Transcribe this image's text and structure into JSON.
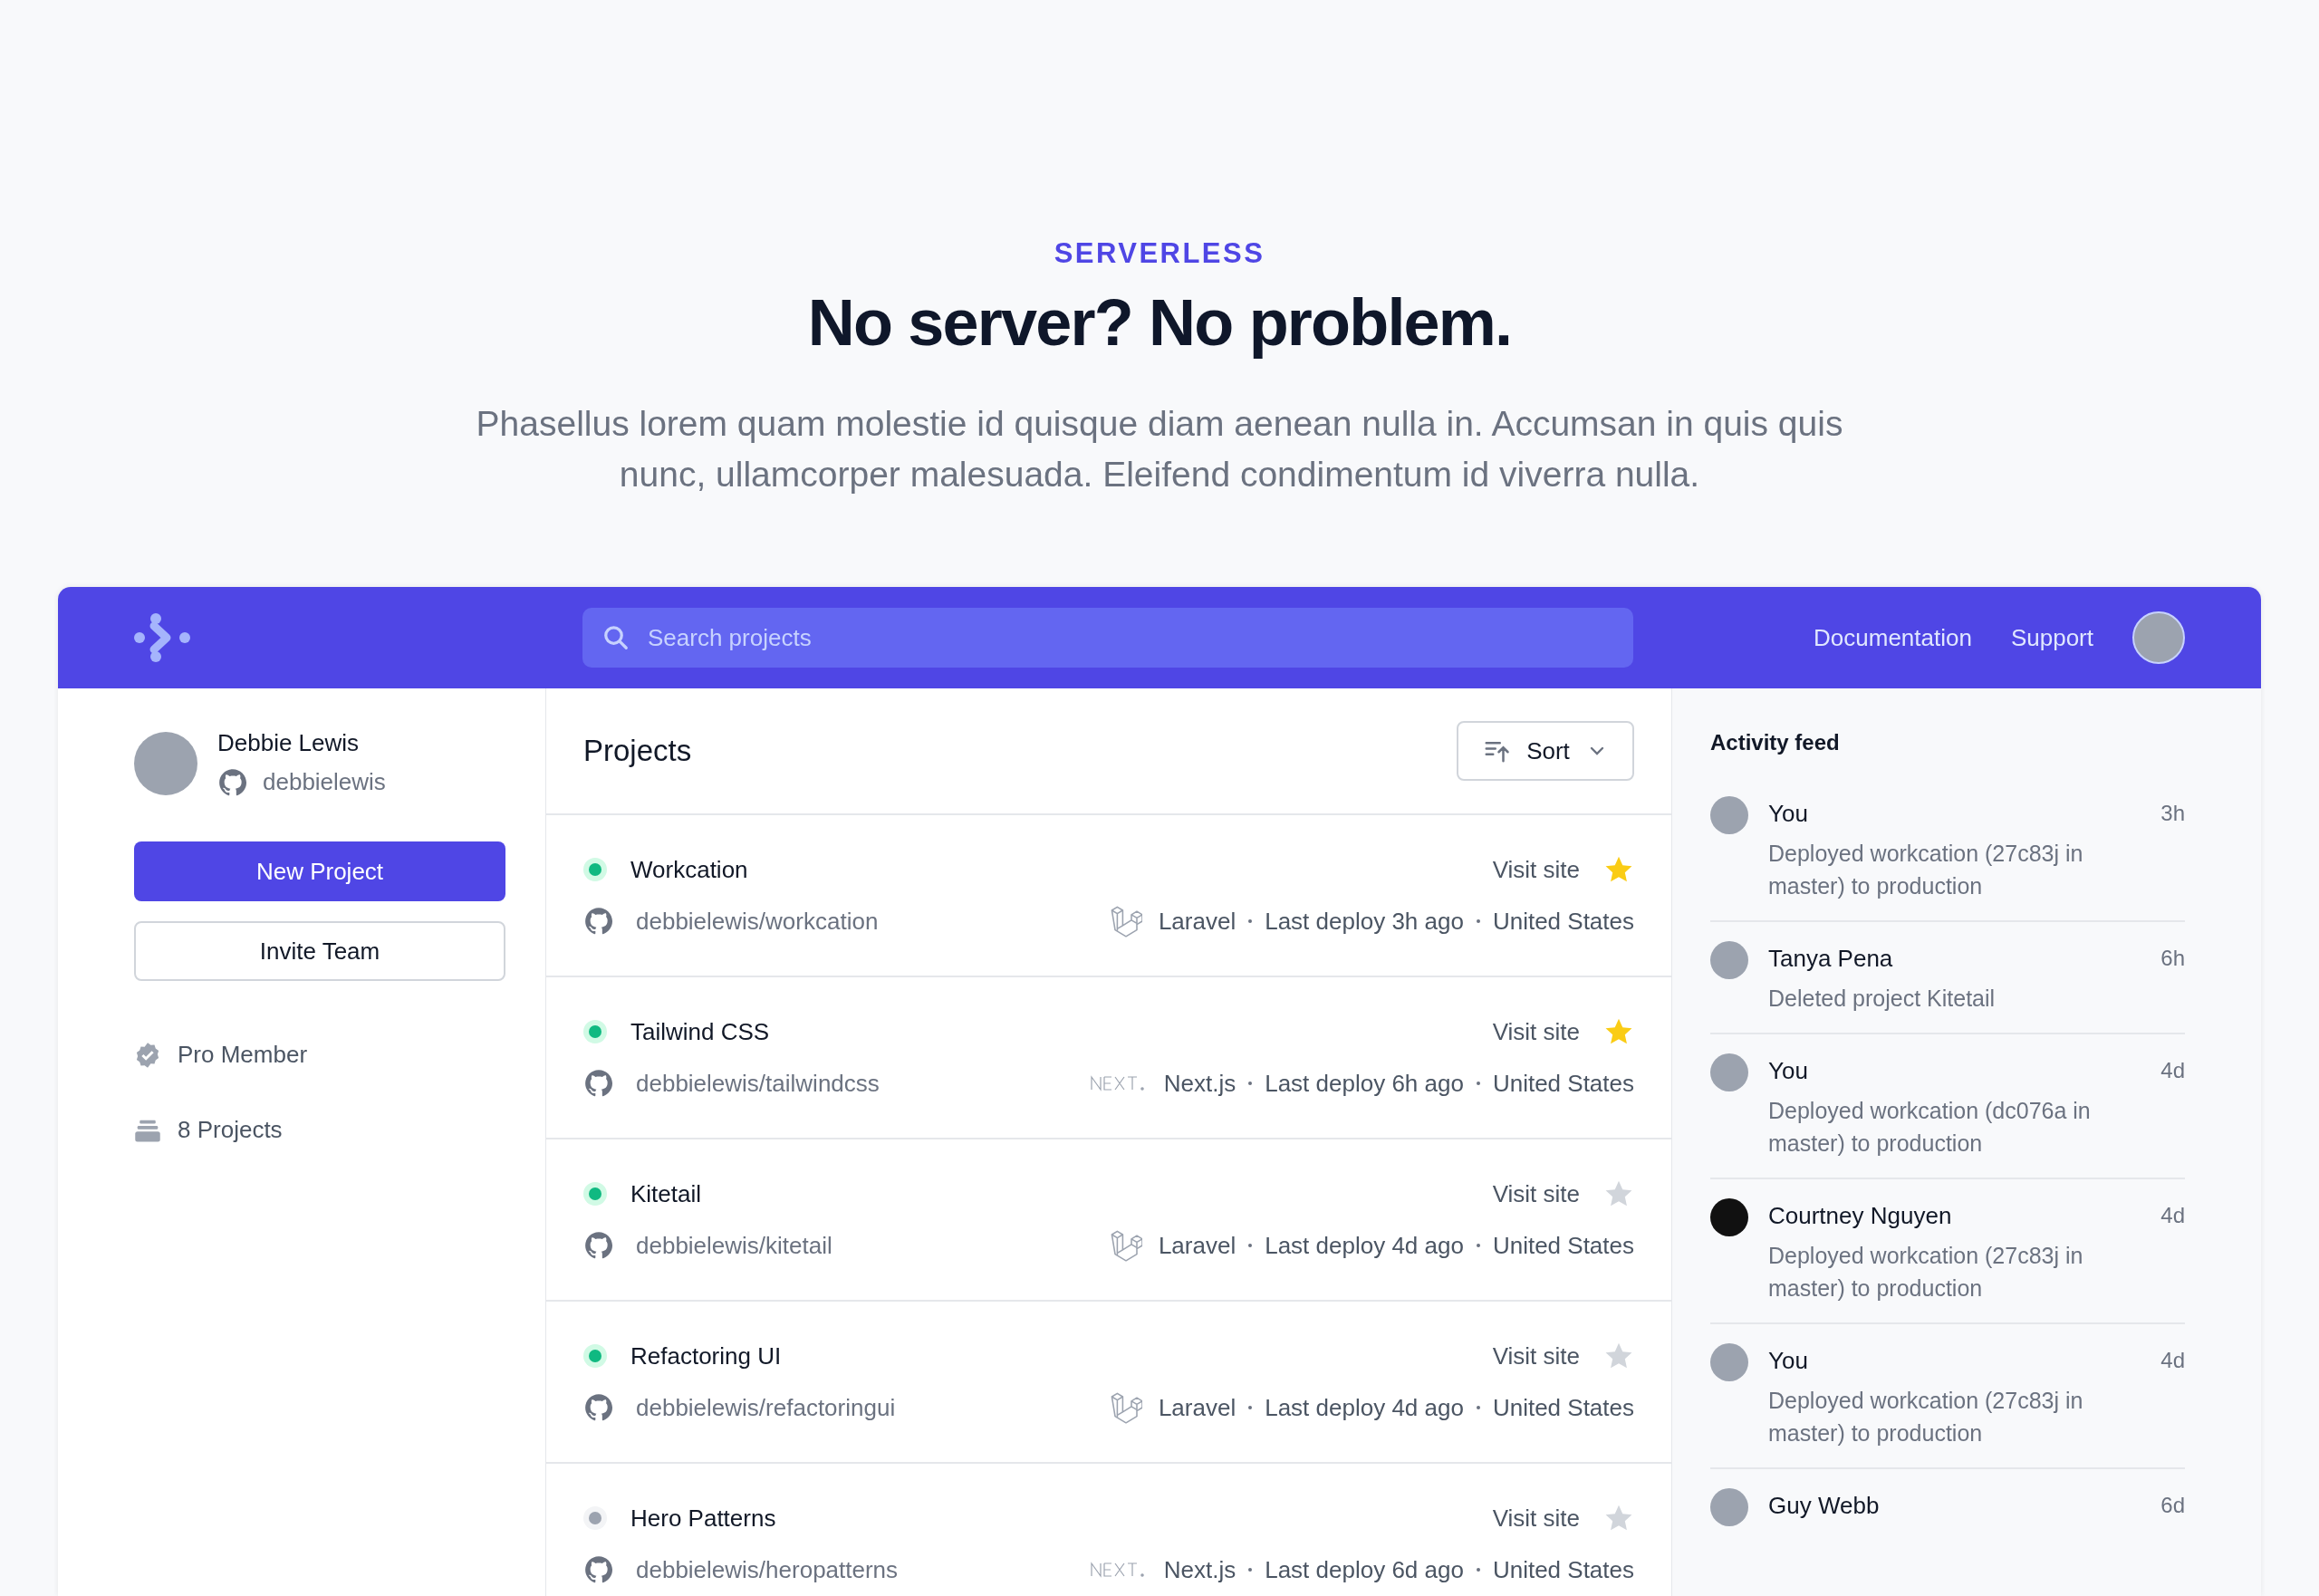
{
  "hero": {
    "eyebrow": "SERVERLESS",
    "title": "No server? No problem.",
    "description": "Phasellus lorem quam molestie id quisque diam aenean nulla in. Accumsan in quis quis nunc, ullamcorper malesuada. Eleifend condimentum id viverra nulla."
  },
  "header": {
    "search": {
      "placeholder": "Search projects"
    },
    "links": [
      "Documentation",
      "Support"
    ]
  },
  "profile": {
    "name": "Debbie Lewis",
    "username": "debbielewis"
  },
  "buttons": [
    {
      "label": "New Project",
      "kind": "primary"
    },
    {
      "label": "Invite Team",
      "kind": "secondary"
    }
  ],
  "stats": [
    {
      "label": "Pro Member",
      "kind": "badge"
    },
    {
      "label": "8 Projects",
      "kind": "stack"
    }
  ],
  "projects": {
    "title": "Projects",
    "sort": "Sort",
    "items": [
      {
        "name": "Workcation",
        "active": true,
        "repo": "debbielewis/workcation",
        "kind": "laravel",
        "framework": "Laravel",
        "deploy": "Last deploy 3h ago",
        "location": "United States",
        "visit": "Visit site",
        "starred": true
      },
      {
        "name": "Tailwind CSS",
        "active": true,
        "repo": "debbielewis/tailwindcss",
        "kind": "next",
        "framework": "Next.js",
        "deploy": "Last deploy 6h ago",
        "location": "United States",
        "visit": "Visit site",
        "starred": true
      },
      {
        "name": "Kitetail",
        "active": true,
        "repo": "debbielewis/kitetail",
        "kind": "laravel",
        "framework": "Laravel",
        "deploy": "Last deploy 4d ago",
        "location": "United States",
        "visit": "Visit site",
        "starred": false
      },
      {
        "name": "Refactoring UI",
        "active": true,
        "repo": "debbielewis/refactoringui",
        "kind": "laravel",
        "framework": "Laravel",
        "deploy": "Last deploy 4d ago",
        "location": "United States",
        "visit": "Visit site",
        "starred": false
      },
      {
        "name": "Hero Patterns",
        "active": false,
        "repo": "debbielewis/heropatterns",
        "kind": "next",
        "framework": "Next.js",
        "deploy": "Last deploy 6d ago",
        "location": "United States",
        "visit": "Visit site",
        "starred": false
      }
    ]
  },
  "activity": {
    "title": "Activity feed",
    "items": [
      {
        "name": "You",
        "time": "3h",
        "text": "Deployed workcation (27c83j in master) to production",
        "kind": "photo"
      },
      {
        "name": "Tanya Pena",
        "time": "6h",
        "text": "Deleted project Kitetail",
        "kind": "photo"
      },
      {
        "name": "You",
        "time": "4d",
        "text": "Deployed workcation (dc076a in master) to production",
        "kind": "photo"
      },
      {
        "name": "Courtney Nguyen",
        "time": "4d",
        "text": "Deployed workcation (27c83j in master) to production",
        "kind": "dark"
      },
      {
        "name": "You",
        "time": "4d",
        "text": "Deployed workcation (27c83j in master) to production",
        "kind": "photo"
      },
      {
        "name": "Guy Webb",
        "time": "6d",
        "kind": "photo"
      }
    ]
  }
}
